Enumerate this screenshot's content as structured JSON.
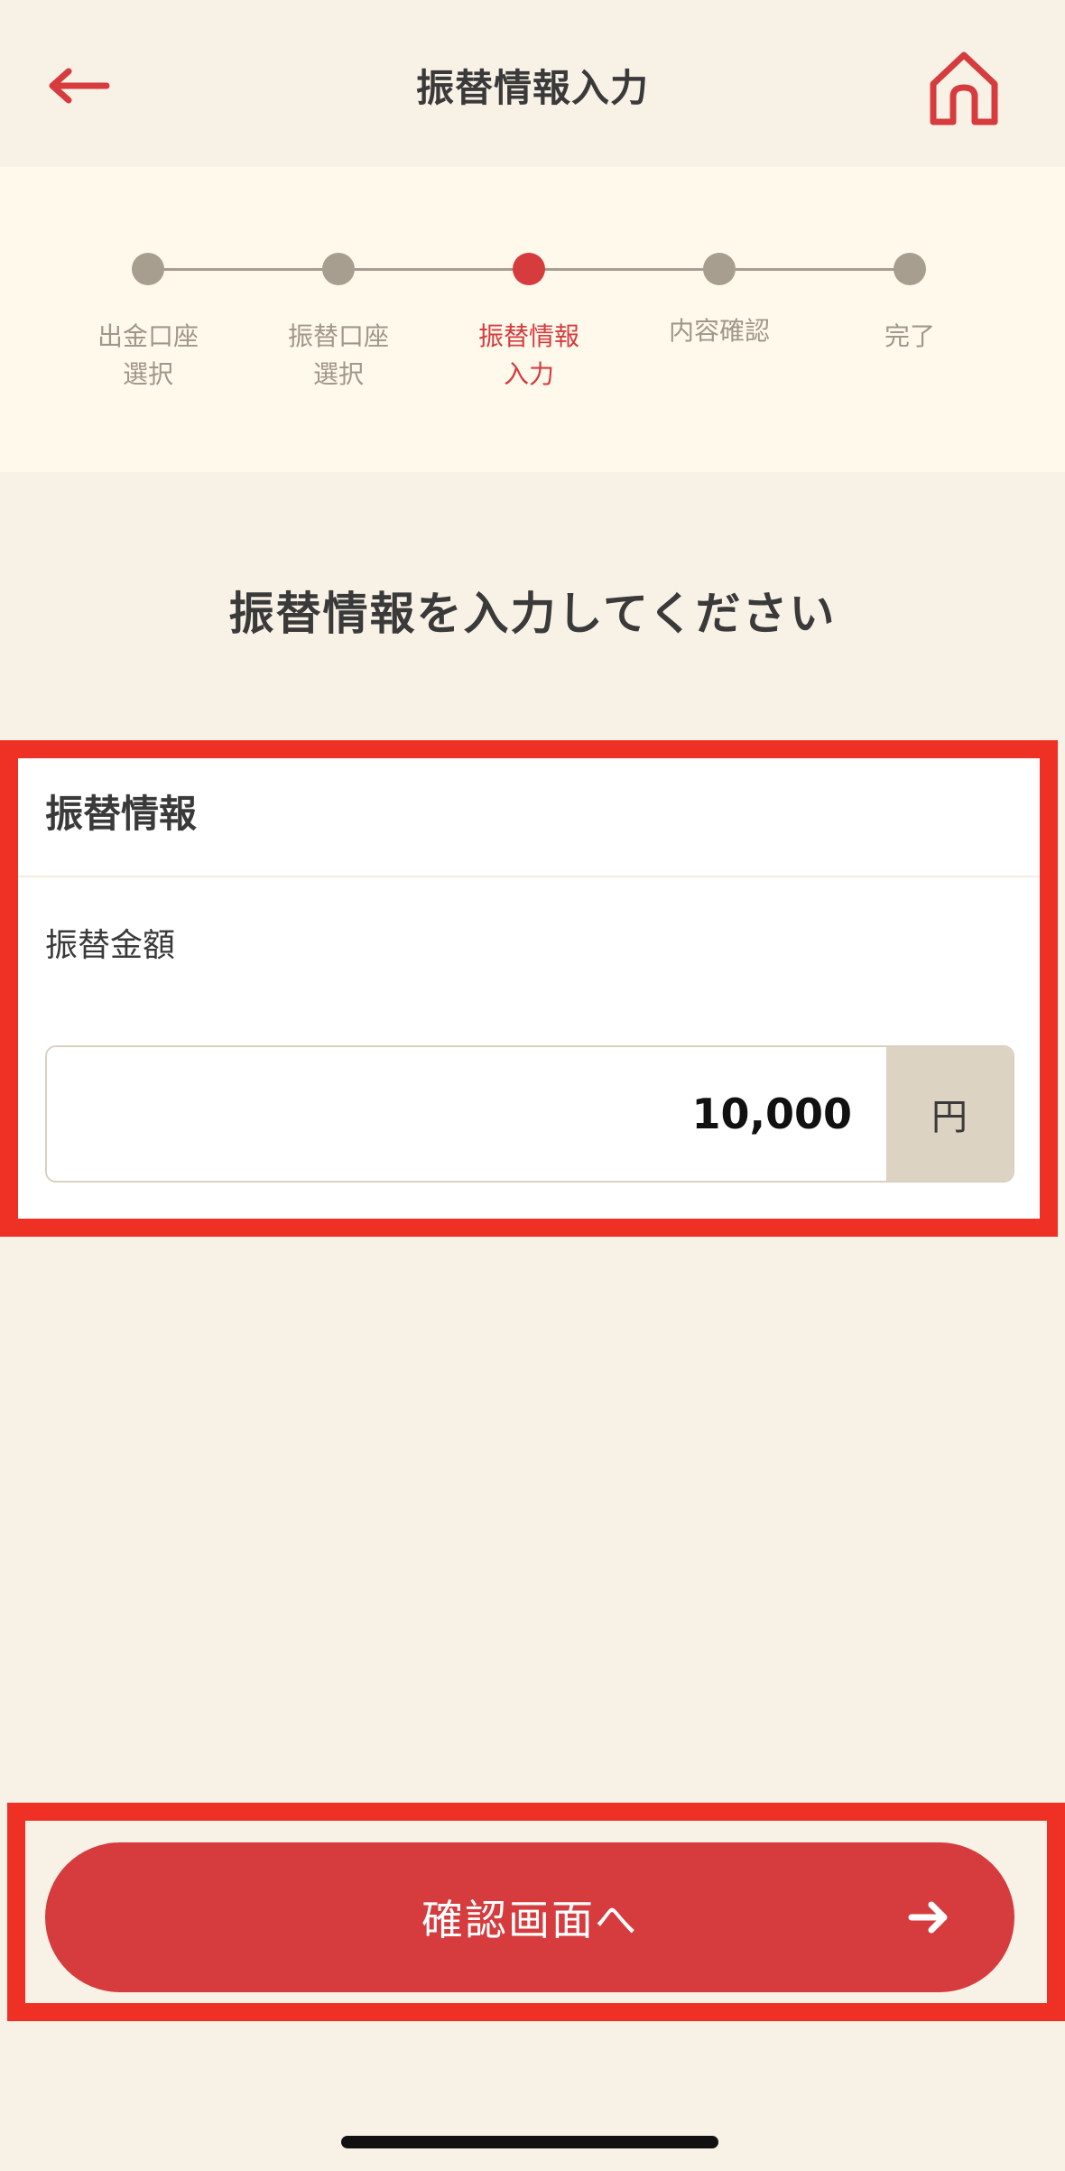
{
  "header": {
    "title": "振替情報入力",
    "back_icon": "arrow-left-icon",
    "home_icon": "home-icon"
  },
  "stepper": {
    "current_step": 3,
    "steps": [
      {
        "label": "出金口座\n選択",
        "state": "done"
      },
      {
        "label": "振替口座\n選択",
        "state": "done"
      },
      {
        "label": "振替情報\n入力",
        "state": "active"
      },
      {
        "label": "内容確認",
        "state": "pending"
      },
      {
        "label": "完了",
        "state": "pending"
      }
    ]
  },
  "instruction": "振替情報を入力してください",
  "card": {
    "title": "振替情報",
    "field_label": "振替金額",
    "amount_value": "10,000",
    "unit": "円"
  },
  "confirm_button": {
    "label": "確認画面へ",
    "icon": "arrow-right-icon"
  },
  "colors": {
    "accent": "#d63b3e",
    "background": "#f8f1e6",
    "stepper_background": "#fff9ec",
    "highlight": "#ee3124"
  }
}
